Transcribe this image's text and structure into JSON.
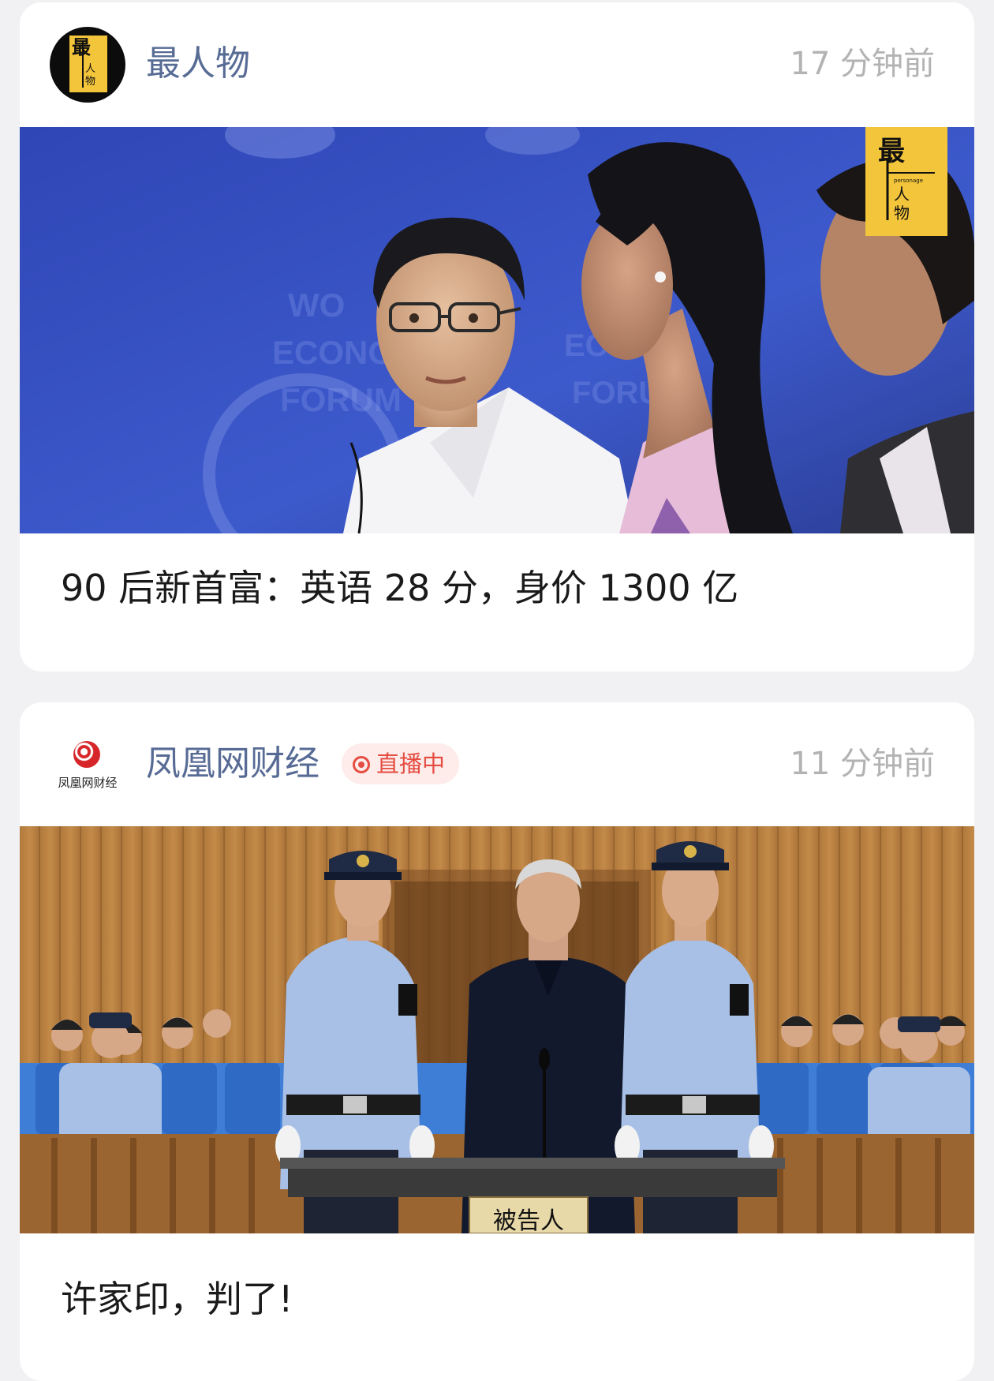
{
  "feed": [
    {
      "source": "最人物",
      "avatar_text": {
        "big": "最",
        "small1": "人",
        "small2": "物"
      },
      "time": "17 分钟前",
      "image_badge": {
        "big": "最",
        "small1": "人",
        "small2": "物",
        "micro": "personage"
      },
      "title": "90 后新首富：英语 28 分，身价 1300 亿",
      "image_icon": "man-at-forum-photo"
    },
    {
      "source": "凤凰网财经",
      "avatar_text": "凤凰网财经",
      "live_badge": "直播中",
      "time": "11 分钟前",
      "image_sign": "被告人",
      "title": "许家印，判了!",
      "image_icon": "courtroom-photo"
    }
  ],
  "colors": {
    "source_link": "#576b95",
    "time": "#b3b3b3",
    "live_red": "#e54d42",
    "brand_yellow": "#f3c53a"
  }
}
